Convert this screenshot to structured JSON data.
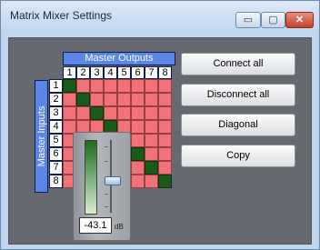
{
  "window": {
    "title": "Matrix Mixer Settings",
    "minimize_glyph": "▭",
    "maximize_glyph": "▢",
    "close_glyph": "✕"
  },
  "matrix": {
    "outputs_label": "Master Outputs",
    "inputs_label": "Master Inputs",
    "columns": [
      "1",
      "2",
      "3",
      "4",
      "5",
      "6",
      "7",
      "8"
    ],
    "rows": [
      "1",
      "2",
      "3",
      "4",
      "5",
      "6",
      "7",
      "8"
    ],
    "connected": [
      [
        true,
        false,
        false,
        false,
        false,
        false,
        false,
        false
      ],
      [
        false,
        true,
        false,
        false,
        false,
        false,
        false,
        false
      ],
      [
        false,
        false,
        true,
        false,
        false,
        false,
        false,
        false
      ],
      [
        false,
        false,
        false,
        true,
        false,
        false,
        false,
        false
      ],
      [
        false,
        false,
        false,
        false,
        true,
        false,
        false,
        false
      ],
      [
        false,
        false,
        false,
        false,
        false,
        true,
        false,
        false
      ],
      [
        false,
        false,
        false,
        false,
        false,
        false,
        true,
        false
      ],
      [
        false,
        false,
        false,
        false,
        false,
        false,
        false,
        true
      ]
    ],
    "colors": {
      "connected": "#1c5a1a",
      "disconnected": "#f2727a",
      "header": "#5b86e6"
    }
  },
  "buttons": {
    "connect_all": "Connect all",
    "disconnect_all": "Disconnect all",
    "diagonal": "Diagonal",
    "copy": "Copy"
  },
  "fader": {
    "value": "-43.1",
    "unit": "dB"
  }
}
